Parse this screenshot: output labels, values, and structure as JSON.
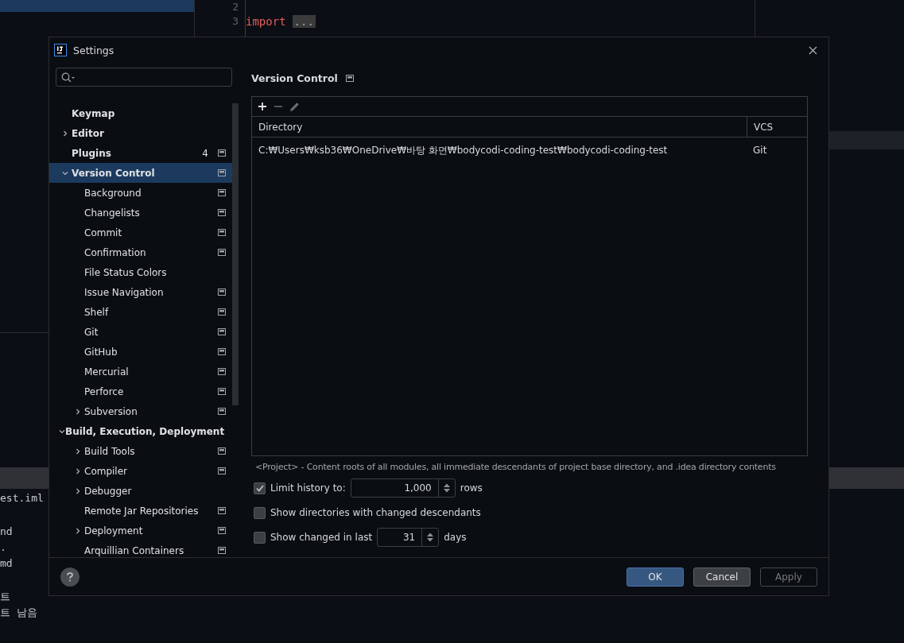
{
  "background": {
    "editor": {
      "lines": [
        {
          "number": "2"
        },
        {
          "number": "3",
          "code": "import",
          "folded": "..."
        }
      ]
    },
    "project_files": [
      {
        "name": "est.iml",
        "gap_before": false
      },
      {
        "name": "nd",
        "gap_before": true
      },
      {
        "name": ".",
        "gap_before": false
      },
      {
        "name": "md",
        "gap_before": false
      },
      {
        "name": "트",
        "gap_before": true
      },
      {
        "name": "트 남음",
        "gap_before": false
      }
    ]
  },
  "dialog": {
    "title": "Settings",
    "sidebar": {
      "tree": [
        {
          "label": "Keymap",
          "kind": "leaf",
          "project_icon": false,
          "selected": false
        },
        {
          "label": "Editor",
          "kind": "folder",
          "expanded": false,
          "project_icon": false,
          "selected": false
        },
        {
          "label": "Plugins",
          "kind": "leaf",
          "badge": "4",
          "project_icon": true,
          "selected": false
        },
        {
          "label": "Version Control",
          "kind": "folder",
          "expanded": true,
          "selected": true,
          "project_icon": true,
          "children": [
            {
              "label": "Background",
              "kind": "leaf",
              "project_icon": true,
              "selected": false
            },
            {
              "label": "Changelists",
              "kind": "leaf",
              "project_icon": true,
              "selected": false
            },
            {
              "label": "Commit",
              "kind": "leaf",
              "project_icon": true,
              "selected": false
            },
            {
              "label": "Confirmation",
              "kind": "leaf",
              "project_icon": true,
              "selected": false
            },
            {
              "label": "File Status Colors",
              "kind": "leaf",
              "project_icon": false,
              "selected": false
            },
            {
              "label": "Issue Navigation",
              "kind": "leaf",
              "project_icon": true,
              "selected": false
            },
            {
              "label": "Shelf",
              "kind": "leaf",
              "project_icon": true,
              "selected": false
            },
            {
              "label": "Git",
              "kind": "leaf",
              "project_icon": true,
              "selected": false
            },
            {
              "label": "GitHub",
              "kind": "leaf",
              "project_icon": true,
              "selected": false
            },
            {
              "label": "Mercurial",
              "kind": "leaf",
              "project_icon": true,
              "selected": false
            },
            {
              "label": "Perforce",
              "kind": "leaf",
              "project_icon": true,
              "selected": false
            },
            {
              "label": "Subversion",
              "kind": "folder",
              "expanded": false,
              "project_icon": true,
              "selected": false
            }
          ]
        },
        {
          "label": "Build, Execution, Deployment",
          "kind": "folder",
          "expanded": true,
          "project_icon": false,
          "selected": false,
          "children": [
            {
              "label": "Build Tools",
              "kind": "folder",
              "expanded": false,
              "project_icon": true,
              "selected": false
            },
            {
              "label": "Compiler",
              "kind": "folder",
              "expanded": false,
              "project_icon": true,
              "selected": false
            },
            {
              "label": "Debugger",
              "kind": "folder",
              "expanded": false,
              "project_icon": false,
              "selected": false
            },
            {
              "label": "Remote Jar Repositories",
              "kind": "leaf",
              "project_icon": true,
              "selected": false
            },
            {
              "label": "Deployment",
              "kind": "folder",
              "expanded": false,
              "project_icon": true,
              "selected": false
            },
            {
              "label": "Arquillian Containers",
              "kind": "leaf",
              "project_icon": true,
              "selected": false
            }
          ]
        }
      ]
    },
    "content": {
      "title": "Version Control",
      "project_icon": true,
      "toolbar": [
        {
          "kind": "add",
          "disabled": false
        },
        {
          "kind": "remove",
          "disabled": true
        },
        {
          "kind": "edit",
          "disabled": true
        }
      ],
      "table": {
        "columns": [
          "Directory",
          "VCS"
        ],
        "rows": [
          [
            "C:₩Users₩ksb36₩OneDrive₩바탕 화면₩bodycodi-coding-test₩bodycodi-coding-test",
            "Git"
          ]
        ]
      },
      "note": "<Project> - Content roots of all modules, all immediate descendants of project base directory, and .idea directory contents",
      "options": [
        {
          "kind": "spinner",
          "label": "Limit history to:",
          "checked": true,
          "value": "1,000",
          "suffix": "rows"
        },
        {
          "kind": "plain",
          "label": "Show directories with changed descendants",
          "checked": false
        },
        {
          "kind": "spinner",
          "label": "Show changed in last",
          "checked": false,
          "value": "31",
          "suffix": "days"
        }
      ]
    },
    "buttons": [
      {
        "label": "OK",
        "kind": "primary",
        "disabled": false
      },
      {
        "label": "Cancel",
        "kind": "default",
        "disabled": false
      },
      {
        "label": "Apply",
        "kind": "default",
        "disabled": true
      }
    ]
  }
}
